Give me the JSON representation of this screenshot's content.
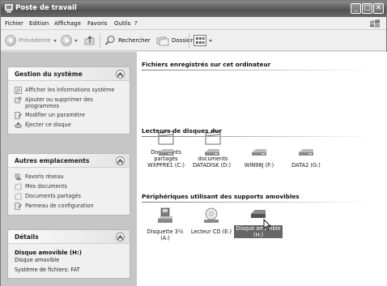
{
  "window": {
    "title": "Poste de travail",
    "buttons": {
      "minimize": "_",
      "maximize": "□",
      "close": "✕"
    }
  },
  "menu": [
    "Fichier",
    "Edition",
    "Affichage",
    "Favoris",
    "Outils",
    "?"
  ],
  "toolbar": {
    "back_label": "Précédente",
    "search_label": "Rechercher",
    "folders_label": "Dossiers"
  },
  "left": {
    "system_tasks": {
      "title": "Gestion du système",
      "items": [
        {
          "label": "Afficher les informations système",
          "icon": "system-info-icon"
        },
        {
          "label": "Ajouter ou supprimer des programmes",
          "icon": "add-remove-programs-icon"
        },
        {
          "label": "Modifier un paramètre",
          "icon": "control-panel-icon"
        },
        {
          "label": "Éjecter ce disque",
          "icon": "eject-icon"
        }
      ]
    },
    "other_places": {
      "title": "Autres emplacements",
      "items": [
        {
          "label": "Favoris réseau",
          "icon": "network-places-icon"
        },
        {
          "label": "Mes documents",
          "icon": "my-documents-icon"
        },
        {
          "label": "Documents partagés",
          "icon": "shared-documents-icon"
        },
        {
          "label": "Panneau de configuration",
          "icon": "control-panel-icon"
        }
      ]
    },
    "details": {
      "title": "Détails",
      "name": "Disque amovible (H:)",
      "type": "Disque amovible",
      "filesystem": "Système de fichiers: FAT"
    }
  },
  "main": {
    "sections": [
      {
        "title": "Fichiers enregistrés sur cet ordinateur",
        "items": [
          {
            "label1": "Documents",
            "label2": "partagés",
            "icon": "folder-icon"
          },
          {
            "label1": "Mes",
            "label2": "documents",
            "icon": "folder-icon"
          }
        ]
      },
      {
        "title": "Lecteurs de disques dur",
        "items": [
          {
            "label1": "WXPFRE1 (C:)",
            "icon": "hard-drive-icon"
          },
          {
            "label1": "DATADISK (D:)",
            "icon": "hard-drive-icon"
          },
          {
            "label1": "WIN98J (F:)",
            "icon": "hard-drive-icon"
          },
          {
            "label1": "DATA2 (G:)",
            "icon": "hard-drive-icon"
          }
        ]
      },
      {
        "title": "Périphériques utilisant des supports amovibles",
        "items": [
          {
            "label1": "Disquette 3½",
            "label2": "(A:)",
            "icon": "floppy-drive-icon"
          },
          {
            "label1": "Lecteur CD (E:)",
            "icon": "cd-drive-icon"
          },
          {
            "label1": "Disque amovible",
            "label2": "(H:)",
            "icon": "removable-drive-icon",
            "selected": true
          }
        ]
      }
    ]
  }
}
